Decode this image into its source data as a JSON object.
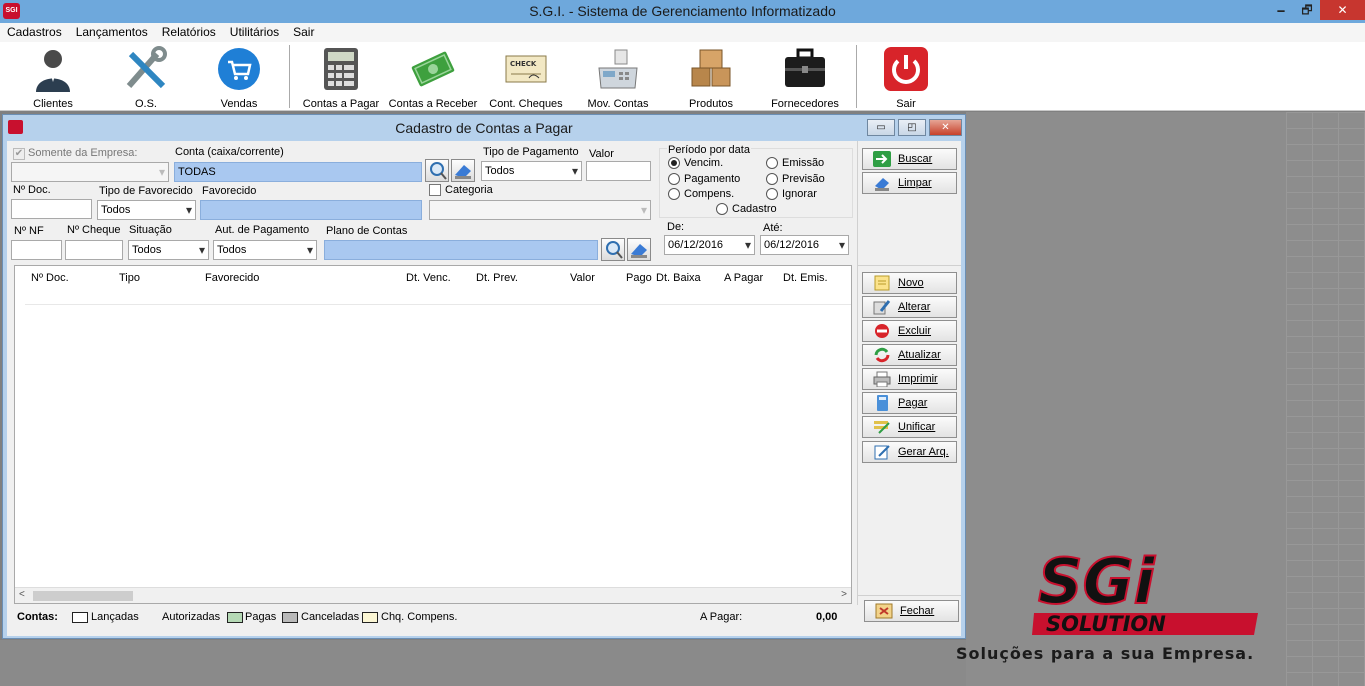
{
  "window": {
    "title": "S.G.I. - Sistema de Gerenciamento Informatizado",
    "minimize_glyph": "🗕",
    "restore_glyph": "🗗",
    "close_glyph": "✕"
  },
  "menu": [
    "Cadastros",
    "Lançamentos",
    "Relatórios",
    "Utilitários",
    "Sair"
  ],
  "toolbar": [
    {
      "label": "Clientes",
      "icon": "user-icon"
    },
    {
      "label": "O.S.",
      "icon": "tools-icon"
    },
    {
      "label": "Vendas",
      "icon": "cart-icon"
    },
    {
      "label": "Contas a Pagar",
      "icon": "calculator-icon"
    },
    {
      "label": "Contas a Receber",
      "icon": "money-icon"
    },
    {
      "label": "Cont. Cheques",
      "icon": "check-icon"
    },
    {
      "label": "Mov. Contas",
      "icon": "cash-register-icon"
    },
    {
      "label": "Produtos",
      "icon": "boxes-icon"
    },
    {
      "label": "Fornecedores",
      "icon": "briefcase-icon"
    },
    {
      "label": "Sair",
      "icon": "power-icon"
    }
  ],
  "check_icon_text": "CHECK",
  "child": {
    "title": "Cadastro de Contas a Pagar",
    "min_glyph": "▭",
    "max_glyph": "◰",
    "close_glyph": "✕"
  },
  "filters": {
    "somente_empresa": "Somente da Empresa:",
    "somente_empresa_checked": "✔",
    "conta_label": "Conta (caixa/corrente)",
    "conta_value": "TODAS",
    "tipo_pagamento_label": "Tipo de Pagamento",
    "tipo_pagamento_value": "Todos",
    "valor_label": "Valor",
    "ndoc_label": "Nº Doc.",
    "tipo_favorecido_label": "Tipo de Favorecido",
    "tipo_favorecido_value": "Todos",
    "favorecido_label": "Favorecido",
    "categoria_label": "Categoria",
    "nnf_label": "Nº NF",
    "ncheque_label": "Nº Cheque",
    "situacao_label": "Situação",
    "situacao_value": "Todos",
    "aut_pagamento_label": "Aut. de Pagamento",
    "aut_pagamento_value": "Todos",
    "plano_contas_label": "Plano de Contas"
  },
  "periodo": {
    "label": "Período por data",
    "options": [
      "Vencim.",
      "Emissão",
      "Pagamento",
      "Previsão",
      "Compens.",
      "Ignorar",
      "Cadastro"
    ],
    "selected": "Vencim.",
    "de_label": "De:",
    "de_value": "06/12/2016",
    "ate_label": "Até:",
    "ate_value": "06/12/2016"
  },
  "actions_top": [
    "Buscar",
    "Limpar"
  ],
  "actions": [
    "Novo",
    "Alterar",
    "Excluir",
    "Atualizar",
    "Imprimir",
    "Pagar",
    "Unificar",
    "Gerar Arq."
  ],
  "fechar": "Fechar",
  "table": {
    "columns": [
      "Nº Doc.",
      "Tipo",
      "Favorecido",
      "Dt. Venc.",
      "Dt. Prev.",
      "Valor",
      "Pago",
      "Dt. Baixa",
      "A Pagar",
      "Dt. Emis."
    ],
    "rows": []
  },
  "scroll": {
    "left": "<",
    "right": ">"
  },
  "legend": {
    "title": "Contas:",
    "items": [
      {
        "label": "Lançadas",
        "color": "#ffffff"
      },
      {
        "label": "Autorizadas",
        "color": ""
      },
      {
        "label": "Pagas",
        "color": "#b5d9b5"
      },
      {
        "label": "Canceladas",
        "color": "#b9b9b9"
      },
      {
        "label": "Chq. Compens.",
        "color": "#fbf6d4"
      }
    ],
    "a_pagar_label": "A Pagar:",
    "a_pagar_value": "0,00"
  },
  "branding": {
    "logo_top": "SGi",
    "logo_bottom": "SOLUTION",
    "tagline": "Soluções para a sua Empresa."
  },
  "colors": {
    "accent_red": "#c8102e",
    "title_blue": "#6ea8dc",
    "field_blue": "#a9c8f0"
  }
}
